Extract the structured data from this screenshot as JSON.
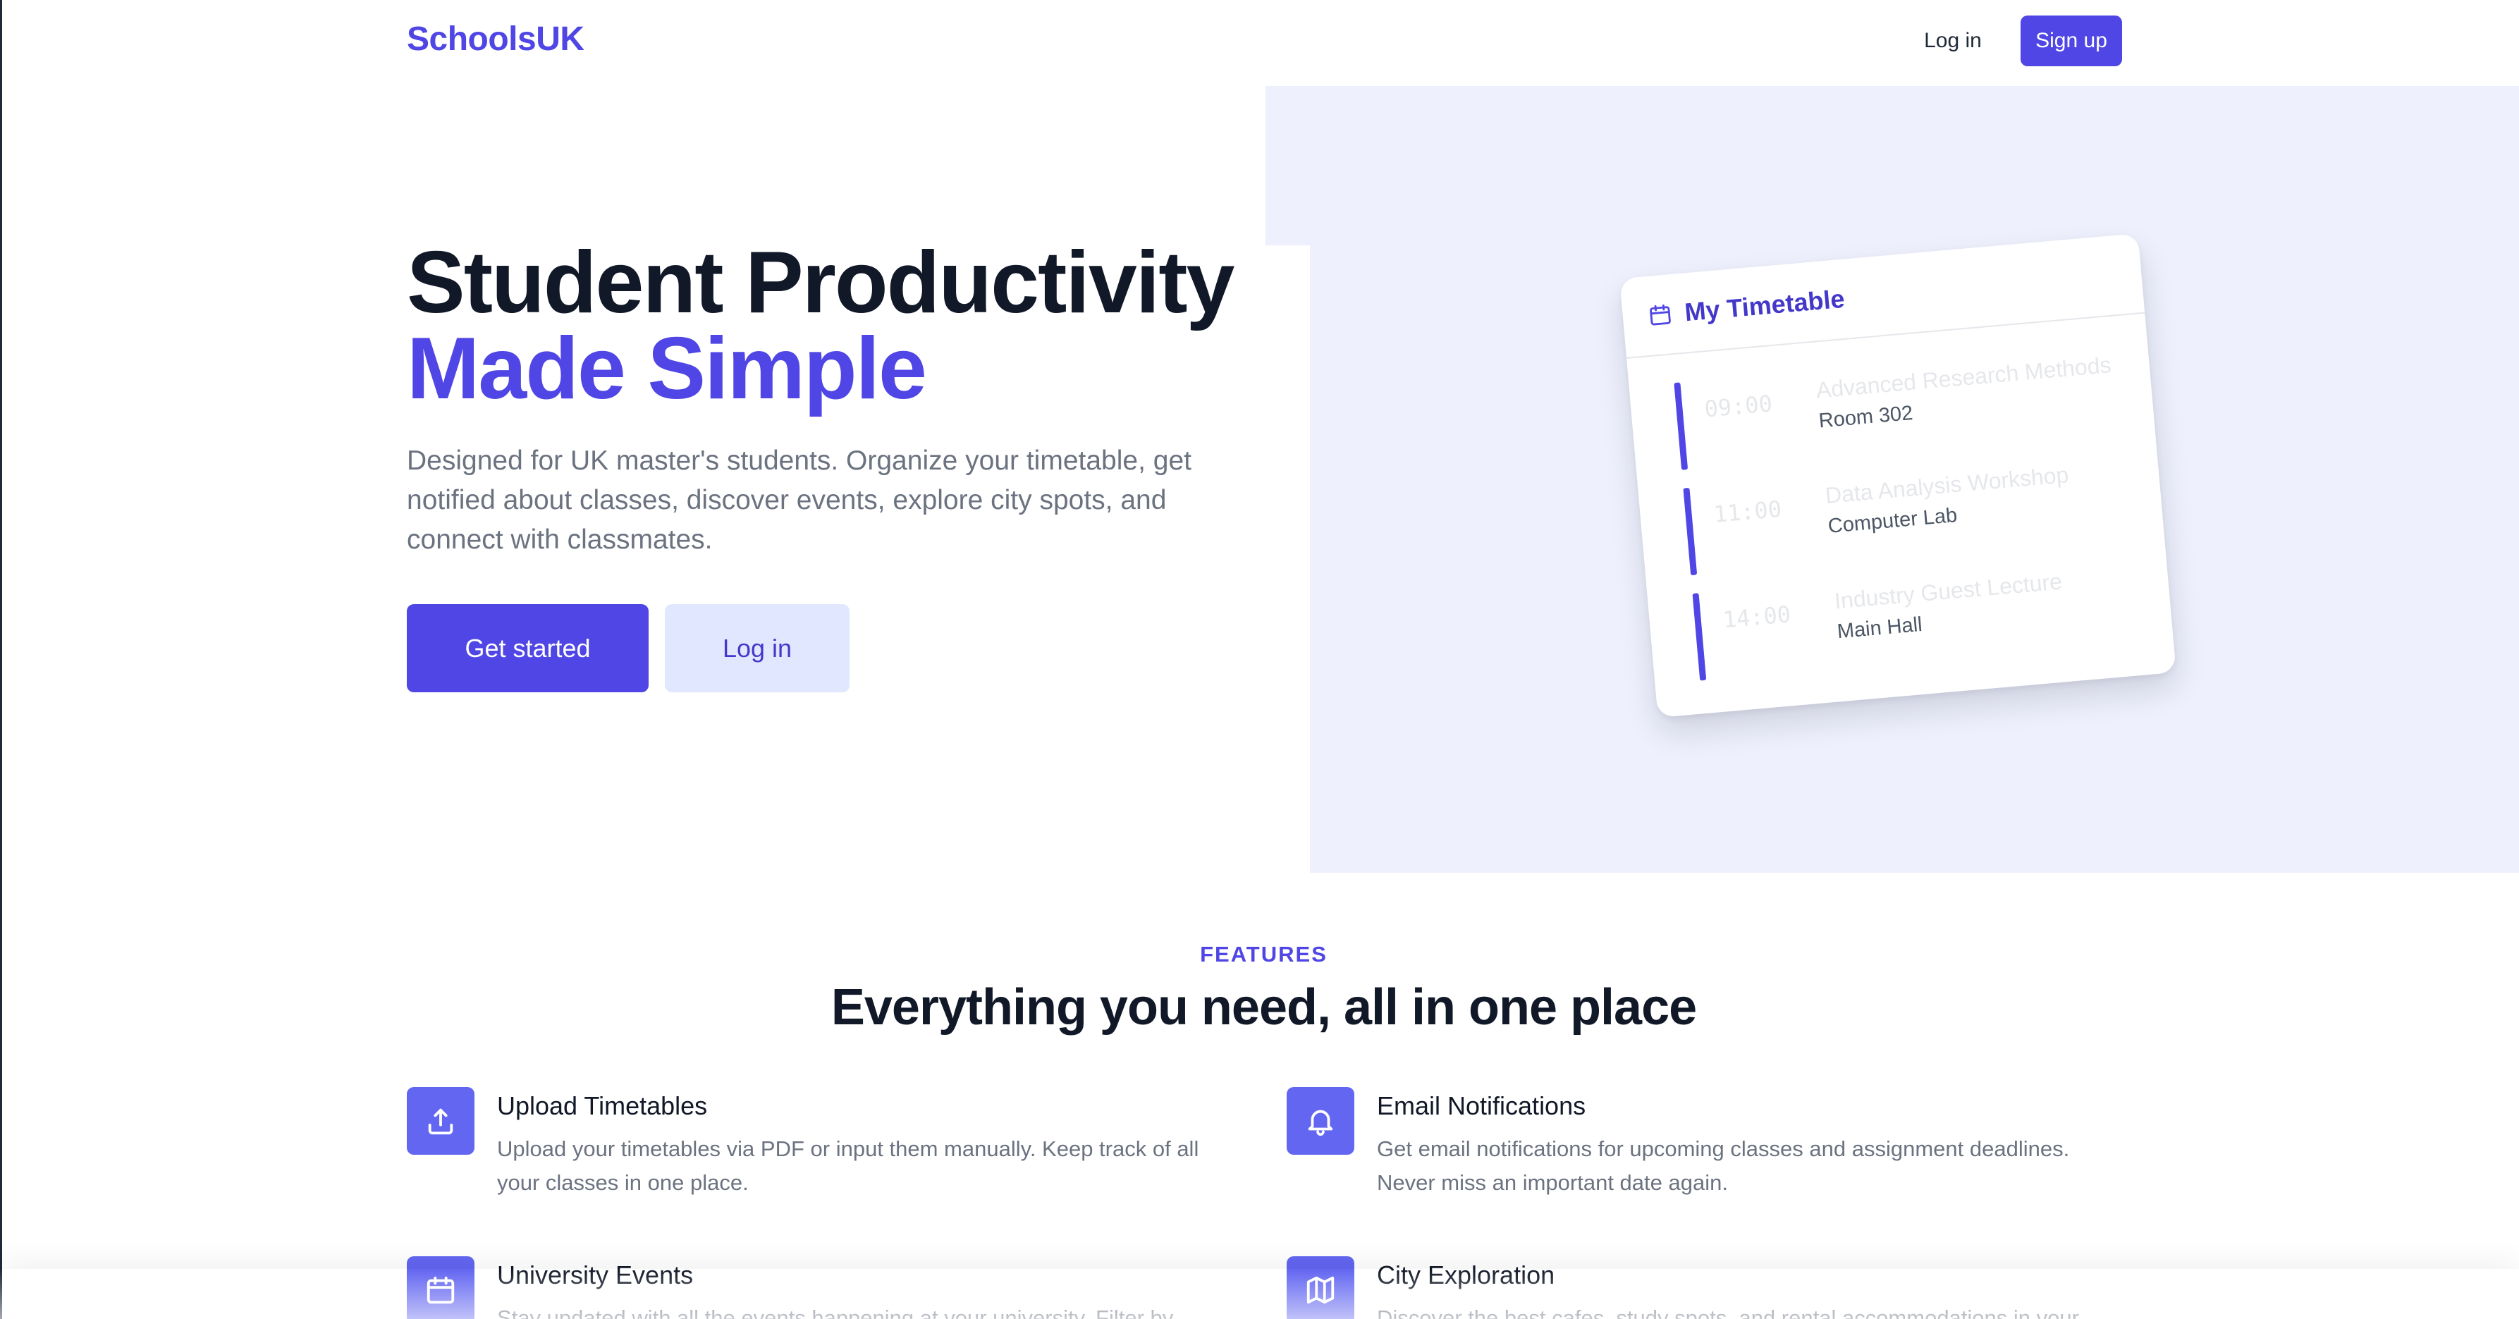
{
  "brand": {
    "name": "SchoolsUK",
    "accent": "#4f46e5"
  },
  "nav": {
    "login_label": "Log in",
    "signup_label": "Sign up"
  },
  "hero": {
    "title_line1": "Student Productivity",
    "title_line2": "Made Simple",
    "description": "Designed for UK master's students. Organize your timetable, get notified about classes, discover events, explore city spots, and connect with classmates.",
    "primary_cta": "Get started",
    "secondary_cta": "Log in"
  },
  "timetable": {
    "title": "My Timetable",
    "icon": "calendar-icon",
    "entries": [
      {
        "time": "09:00",
        "course": "Advanced Research Methods",
        "room": "Room 302"
      },
      {
        "time": "11:00",
        "course": "Data Analysis Workshop",
        "room": "Computer Lab"
      },
      {
        "time": "14:00",
        "course": "Industry Guest Lecture",
        "room": "Main Hall"
      }
    ]
  },
  "features": {
    "label": "FEATURES",
    "title": "Everything you need, all in one place",
    "items": [
      {
        "icon": "upload-icon",
        "name": "Upload Timetables",
        "description": "Upload your timetables via PDF or input them manually. Keep track of all your classes in one place."
      },
      {
        "icon": "bell-icon",
        "name": "Email Notifications",
        "description": "Get email notifications for upcoming classes and assignment deadlines. Never miss an important date again."
      },
      {
        "icon": "calendar-icon",
        "name": "University Events",
        "description": "Stay updated with all the events happening at your university. Filter by"
      },
      {
        "icon": "map-icon",
        "name": "City Exploration",
        "description": "Discover the best cafes, study spots, and rental accommodations in your"
      }
    ]
  }
}
